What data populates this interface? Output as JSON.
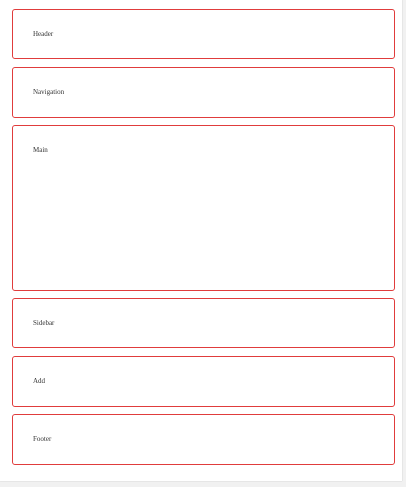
{
  "layout": {
    "header": {
      "label": "Header"
    },
    "navigation": {
      "label": "Navigation"
    },
    "main": {
      "label": "Main"
    },
    "sidebar": {
      "label": "Sidebar"
    },
    "add": {
      "label": "Add"
    },
    "footer": {
      "label": "Footer"
    }
  },
  "colors": {
    "border": "#e03c3c",
    "background": "#ffffff",
    "text": "#333333"
  }
}
